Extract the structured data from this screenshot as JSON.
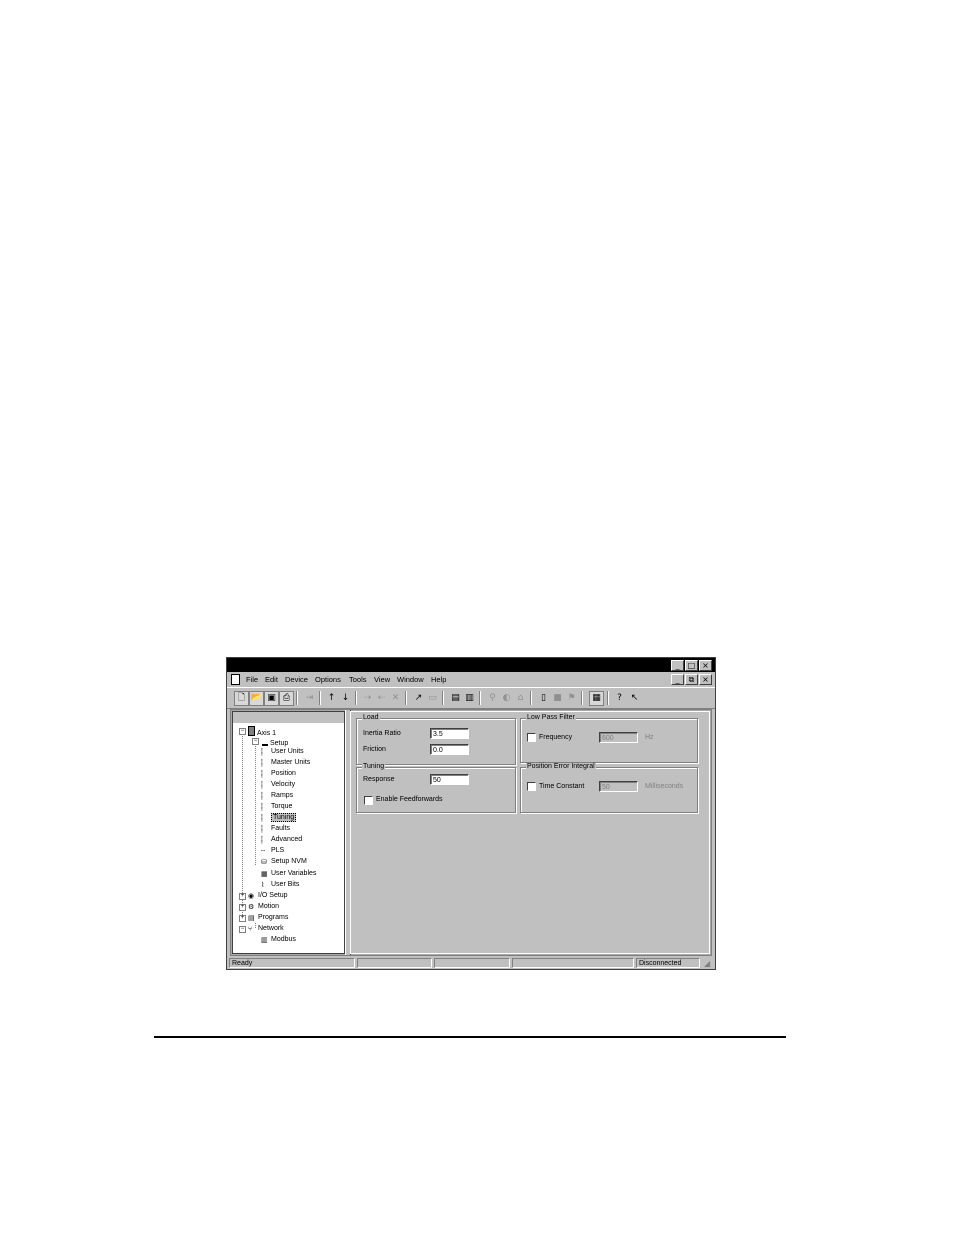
{
  "window": {
    "title": ""
  },
  "title_buttons": [
    "_",
    "□",
    "×"
  ],
  "mdi_buttons": [
    "_",
    "⧉",
    "×"
  ],
  "menu": [
    "File",
    "Edit",
    "Device",
    "Options",
    "Tools",
    "View",
    "Window",
    "Help"
  ],
  "toolbar_icons": [
    "new-icon",
    "open-icon",
    "save-icon",
    "print-icon",
    "import-icon",
    "upload-icon",
    "download-icon",
    "connect-icon",
    "disconnect-icon",
    "delete-icon",
    "run-icon",
    "stop-icon",
    "copy-icon",
    "paste-icon",
    "search-icon",
    "help-icon",
    "settings-icon",
    "save-flash-icon",
    "block-icon",
    "flag-icon",
    "window-icon",
    "help-book-icon",
    "context-help-icon"
  ],
  "tree": {
    "root": "Axis 1",
    "setup": "Setup",
    "setup_children": [
      "User Units",
      "Master Units",
      "Position",
      "Velocity",
      "Ramps",
      "Torque",
      "Tuning",
      "Faults",
      "Advanced",
      "PLS",
      "Setup NVM",
      "User Variables",
      "User Bits"
    ],
    "selected": "Tuning",
    "top_groups": [
      "I/O Setup",
      "Motion",
      "Programs",
      "Network"
    ],
    "network_children": [
      "Modbus"
    ]
  },
  "load": {
    "title": "Load",
    "inertia_ratio_label": "Inertia Ratio",
    "inertia_ratio_value": "3.5",
    "friction_label": "Friction",
    "friction_value": "0.0"
  },
  "tuning": {
    "title": "Tuning",
    "response_label": "Response",
    "response_value": "50",
    "feedforward_label": "Enable Feedforwards",
    "feedforward_checked": false
  },
  "low_pass": {
    "title": "Low Pass Filter",
    "frequency_label": "Frequency",
    "frequency_value": "600",
    "frequency_unit": "Hz",
    "checked": false
  },
  "pos_error": {
    "title": "Position Error Integral",
    "time_constant_label": "Time Constant",
    "time_constant_value": "50",
    "time_constant_unit": "Milliseconds",
    "checked": false
  },
  "status": {
    "left": "Ready",
    "right": "Disconnected"
  }
}
